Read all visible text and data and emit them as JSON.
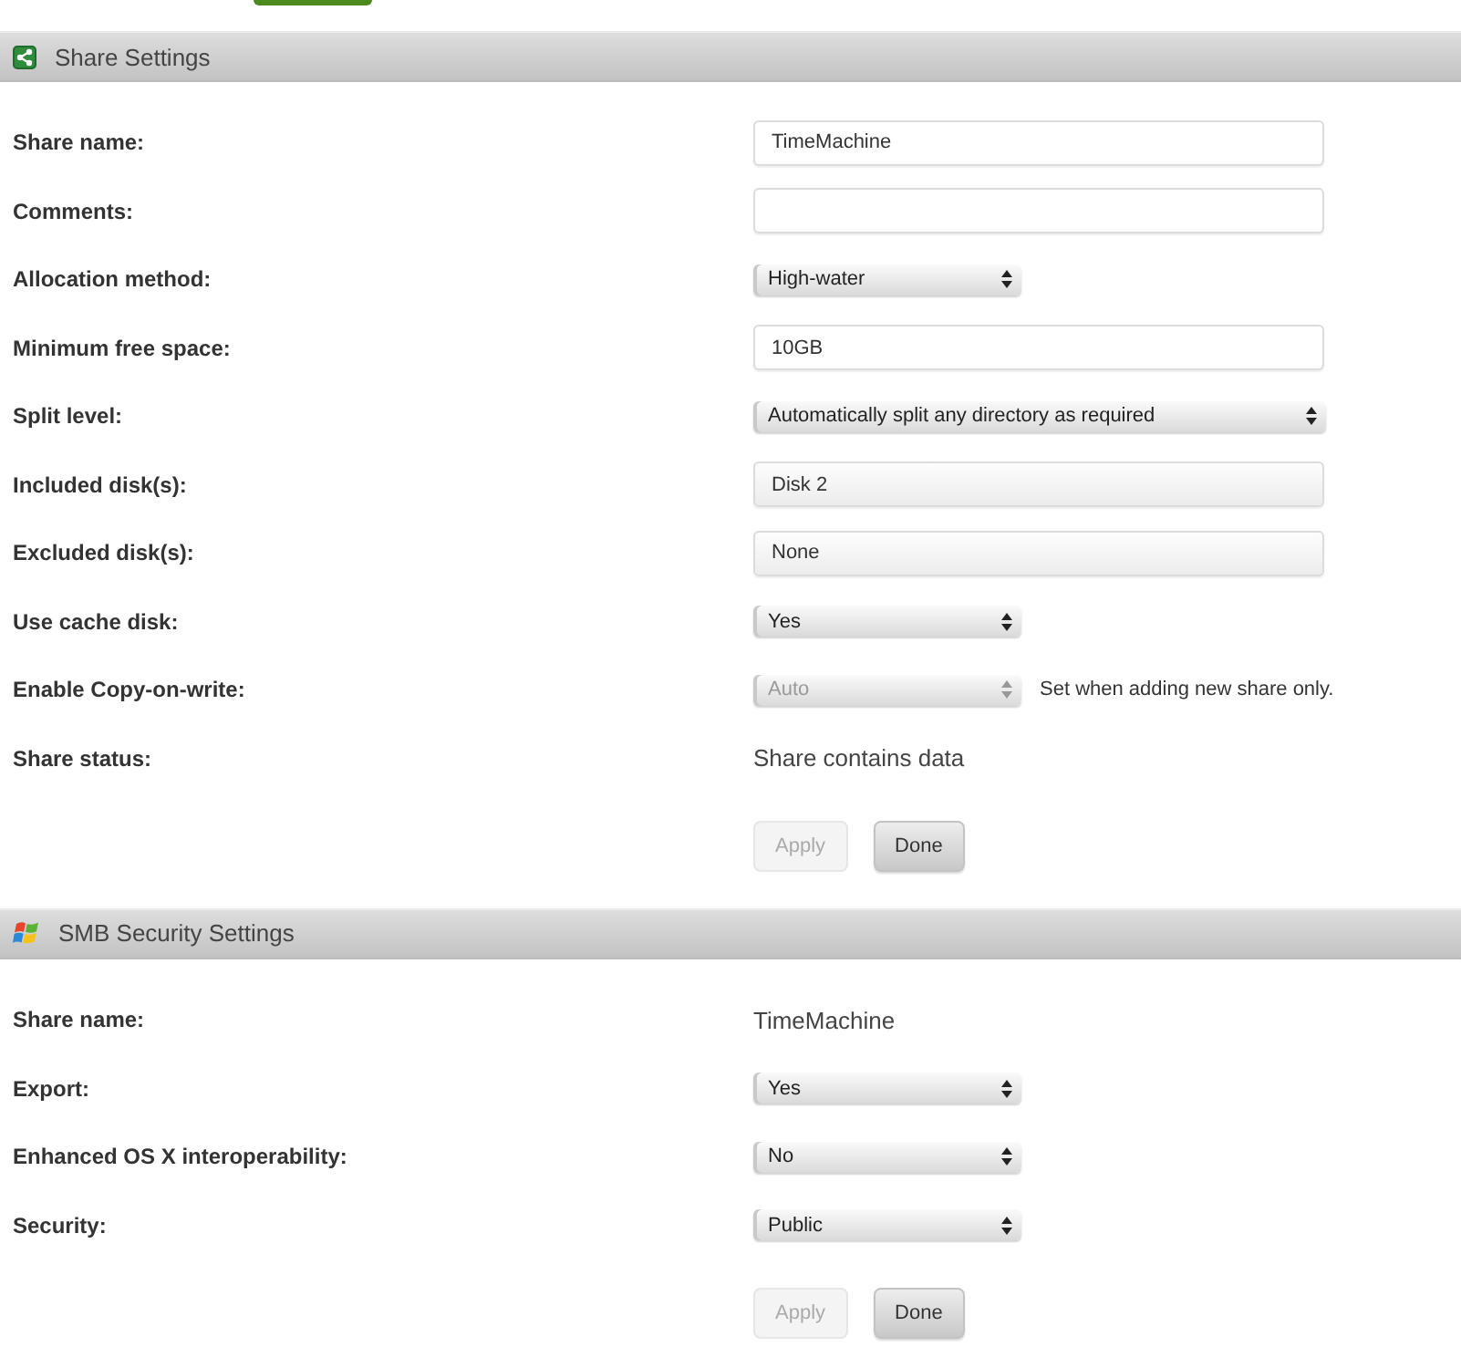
{
  "sections": [
    {
      "title": "Share Settings",
      "fields": [
        {
          "label": "Share name:",
          "kind": "text",
          "value": "TimeMachine",
          "disabled": false
        },
        {
          "label": "Comments:",
          "kind": "text",
          "disabled": false
        },
        {
          "label": "Allocation method:",
          "kind": "select",
          "value": "High-water",
          "disabled": false
        },
        {
          "label": "Minimum free space:",
          "kind": "text",
          "value": "10GB",
          "disabled": false
        },
        {
          "label": "Split level:",
          "kind": "select",
          "value": "Automatically split any directory as required",
          "disabled": false
        },
        {
          "label": "Included disk(s):",
          "kind": "picker",
          "value": "Disk 2",
          "disabled": false
        },
        {
          "label": "Excluded disk(s):",
          "kind": "picker",
          "value": "None",
          "disabled": false
        },
        {
          "label": "Use cache disk:",
          "kind": "select",
          "value": "Yes",
          "disabled": false
        },
        {
          "label": "Enable Copy-on-write:",
          "kind": "select",
          "value": "Auto",
          "disabled": true,
          "note": "Set when adding new share only."
        },
        {
          "label": "Share status:",
          "kind": "static",
          "value": "Share contains data",
          "disabled": false
        }
      ],
      "buttons": [
        {
          "label": "Apply",
          "disabled": true
        },
        {
          "label": "Done",
          "disabled": false
        }
      ]
    },
    {
      "title": "SMB Security Settings",
      "fields": [
        {
          "label": "Share name:",
          "kind": "static",
          "value": "TimeMachine",
          "disabled": false
        },
        {
          "label": "Export:",
          "kind": "select",
          "value": "Yes",
          "disabled": false
        },
        {
          "label": "Enhanced OS X interoperability:",
          "kind": "select",
          "value": "No",
          "disabled": false
        },
        {
          "label": "Security:",
          "kind": "select",
          "value": "Public",
          "disabled": false
        }
      ],
      "buttons": [
        {
          "label": "Apply",
          "disabled": true
        },
        {
          "label": "Done",
          "disabled": false
        }
      ]
    }
  ]
}
